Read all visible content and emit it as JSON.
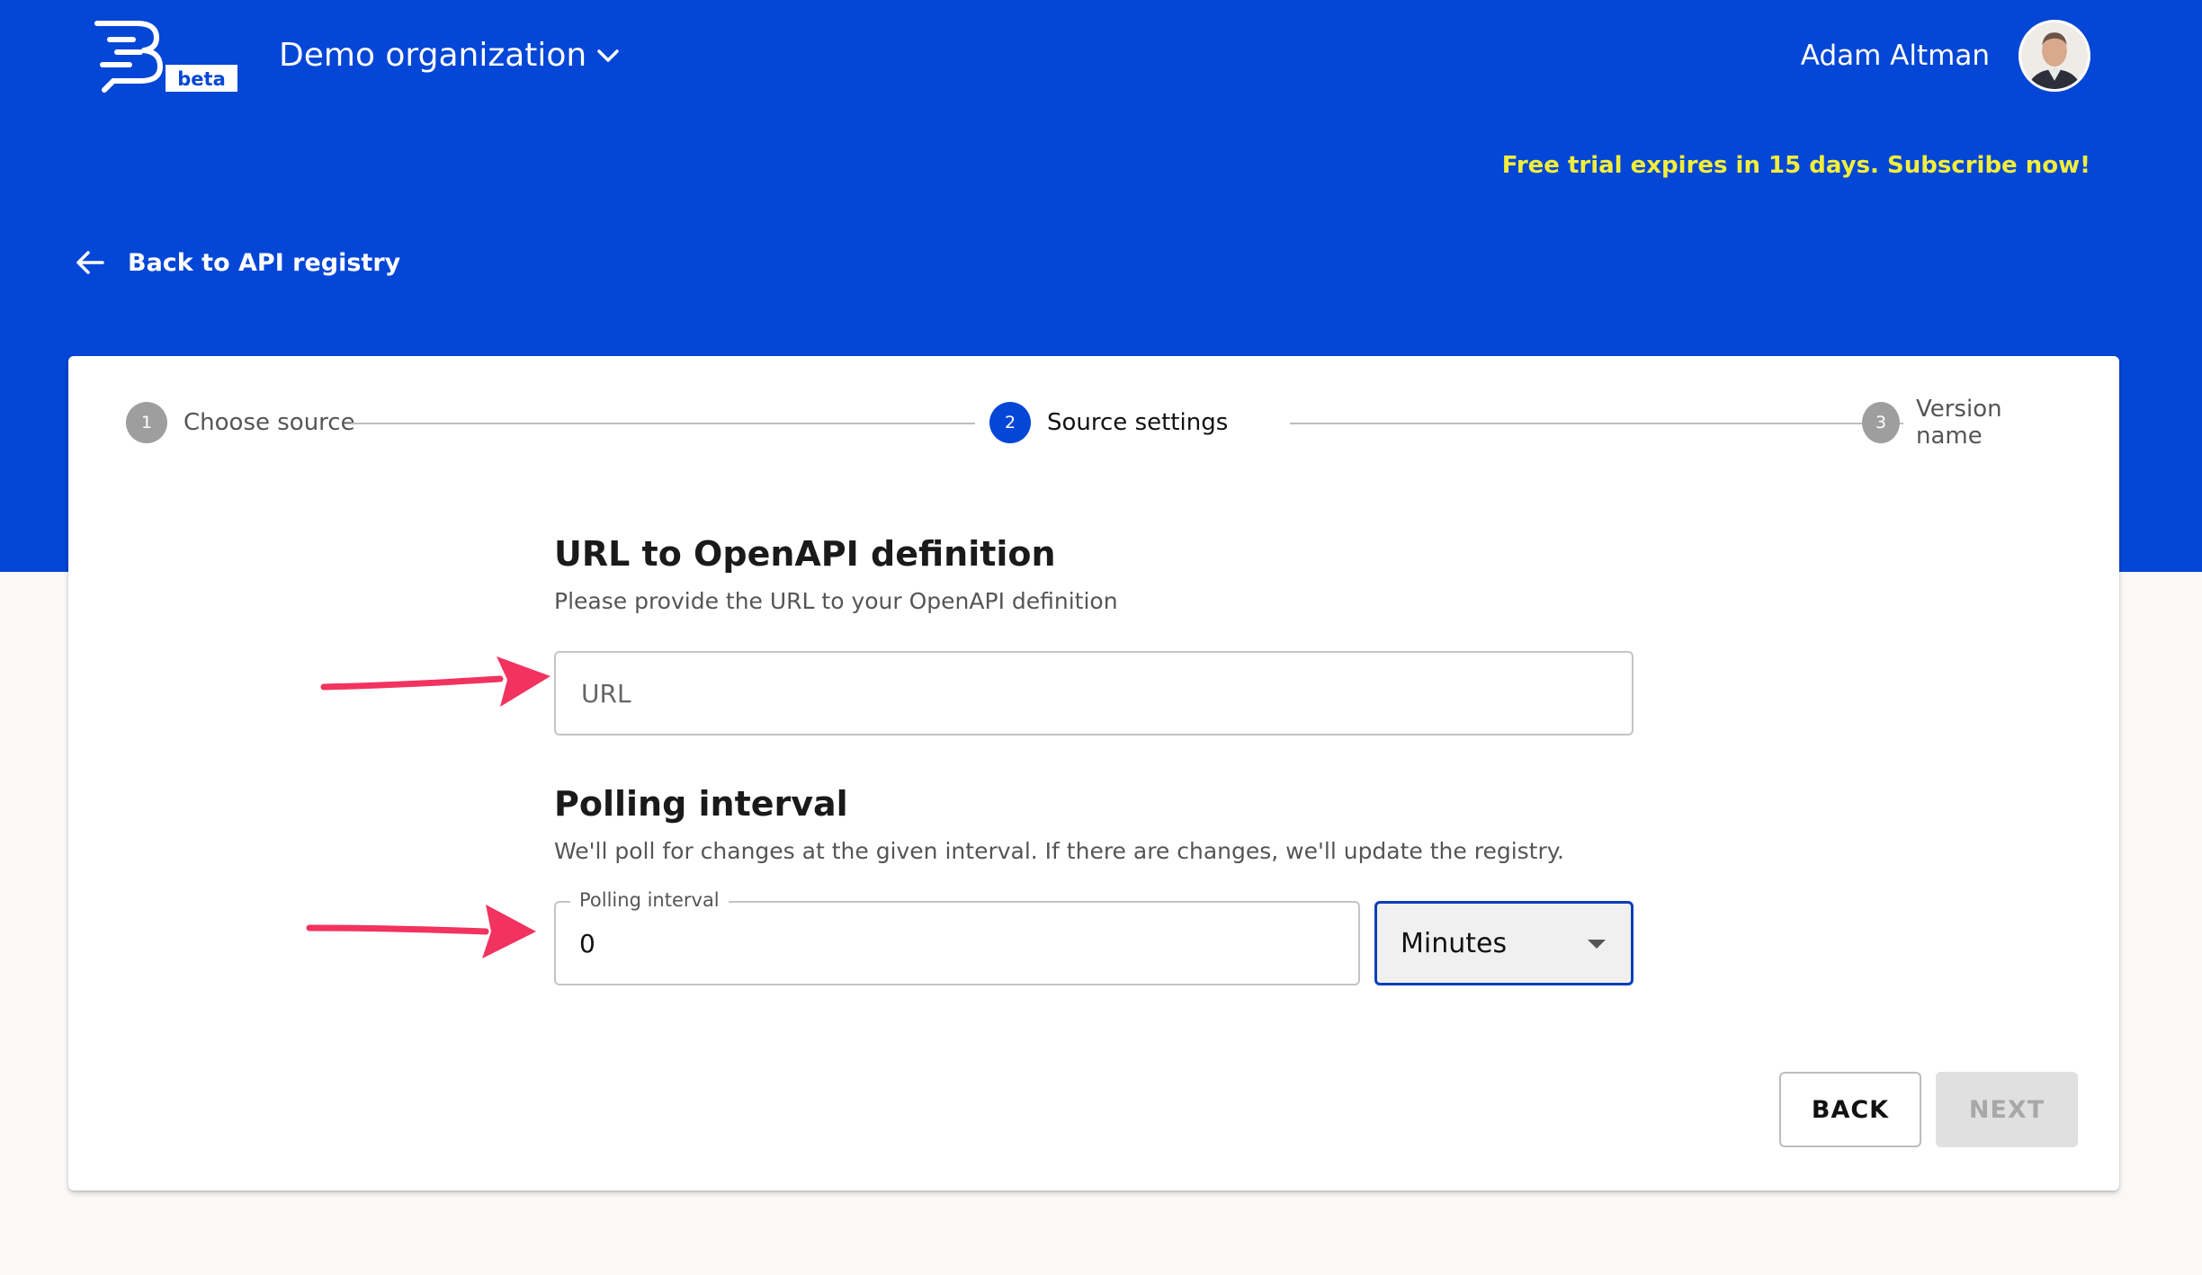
{
  "header": {
    "logo_badge": "beta",
    "org_name": "Demo organization",
    "user_name": "Adam Altman",
    "trial_notice": "Free trial expires in 15 days. Subscribe now!",
    "back_link": "Back to API registry"
  },
  "stepper": {
    "steps": [
      {
        "number": "1",
        "label": "Choose source",
        "state": "done"
      },
      {
        "number": "2",
        "label": "Source settings",
        "state": "active"
      },
      {
        "number": "3",
        "label": "Version name",
        "state": "pending"
      }
    ]
  },
  "url_section": {
    "title": "URL to OpenAPI definition",
    "description": "Please provide the URL to your OpenAPI definition",
    "placeholder": "URL"
  },
  "polling_section": {
    "title": "Polling interval",
    "description": "We'll poll for changes at the given interval. If there are changes, we'll update the registry.",
    "field_label": "Polling interval",
    "value": "0",
    "unit": "Minutes"
  },
  "actions": {
    "back_label": "BACK",
    "next_label": "NEXT"
  },
  "colors": {
    "brand": "#0446d6",
    "trial_text": "#f2ef3a",
    "annotation_arrow": "#f2325f"
  }
}
